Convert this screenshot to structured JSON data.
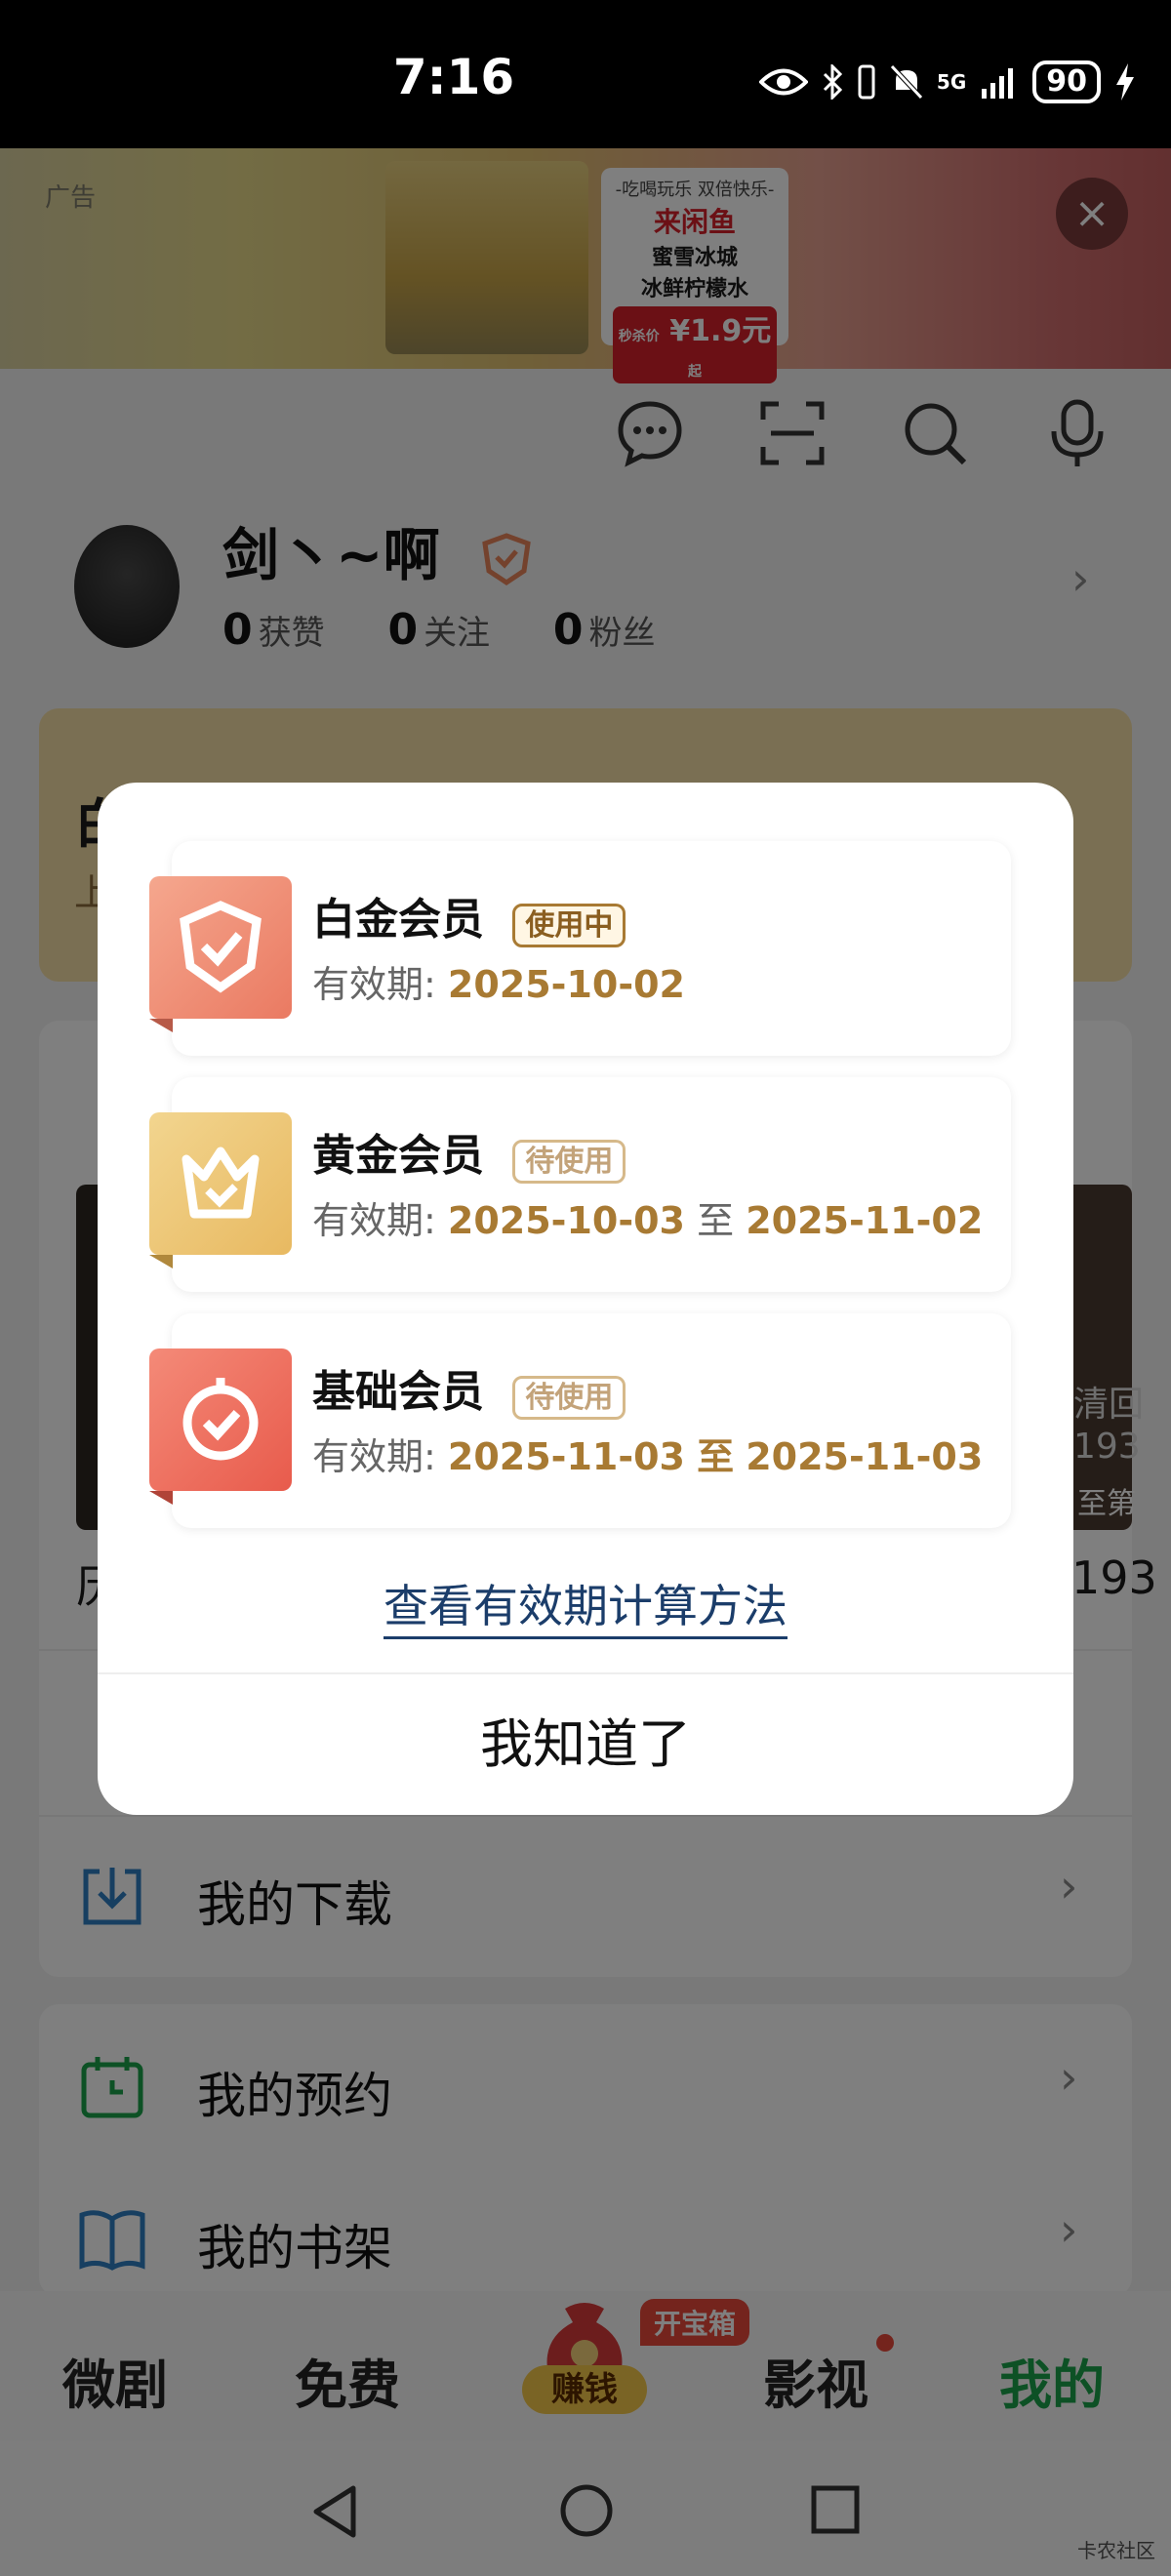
{
  "status_bar": {
    "time": "7:16",
    "battery": "90",
    "network": "5G",
    "icons": [
      "eye-icon",
      "bluetooth-icon",
      "vibrate-icon",
      "mute-icon",
      "signal-icon",
      "battery-icon",
      "charging-icon"
    ]
  },
  "ad": {
    "label": "广告",
    "tagline": "-吃喝玩乐 双倍快乐-",
    "brand": "来闲鱼",
    "line1": "蜜雪冰城",
    "line2": "冰鲜柠檬水",
    "price_prefix": "秒杀价",
    "price": "¥1.9元",
    "price_suffix": "起",
    "close": "×"
  },
  "profile": {
    "name": "剑丶~啊",
    "likes_count": "0",
    "likes_label": "获赞",
    "following_count": "0",
    "following_label": "关注",
    "fans_count": "0",
    "fans_label": "粉丝"
  },
  "background": {
    "gold_card_title": "白",
    "gold_card_sub": "上",
    "poster_left_caption": "历",
    "poster_right_caption": "193",
    "poster_right_text1": "清回",
    "poster_right_text2": "193",
    "poster_right_text3": "至第",
    "list_items": [
      {
        "label": "我的下载"
      },
      {
        "label": "我的预约"
      },
      {
        "label": "我的书架"
      }
    ]
  },
  "bottom_nav": {
    "items": [
      {
        "label": "微剧"
      },
      {
        "label": "免费"
      },
      {
        "label": "赚钱"
      },
      {
        "label": "影视"
      },
      {
        "label": "我的"
      }
    ],
    "treasure_badge": "开宝箱",
    "active": "我的",
    "accent": "#1aa34a"
  },
  "dialog": {
    "memberships": [
      {
        "name": "白金会员",
        "tag": "使用中",
        "valid_label": "有效期:",
        "start": "2025-10-02",
        "sep": "",
        "end": "",
        "icon": "shield-check-icon"
      },
      {
        "name": "黄金会员",
        "tag": "待使用",
        "valid_label": "有效期:",
        "start": "2025-10-03",
        "sep": "至",
        "end": "2025-11-02",
        "icon": "crown-icon"
      },
      {
        "name": "基础会员",
        "tag": "待使用",
        "valid_label": "有效期:",
        "start": "2025-11-03",
        "sep": "至",
        "end": "2025-11-03",
        "icon": "check-badge-icon"
      }
    ],
    "link": "查看有效期计算方法",
    "confirm": "我知道了"
  },
  "watermark": "卡农社区"
}
